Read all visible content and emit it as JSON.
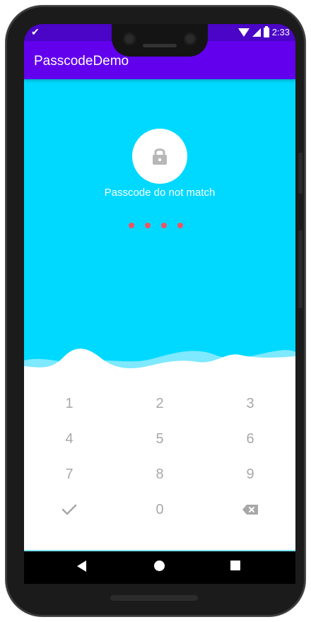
{
  "status_bar": {
    "time": "2:33",
    "notification_icon": "check-icon",
    "icons": [
      "wifi-icon",
      "signal-icon",
      "battery-icon"
    ],
    "background_color": "#4a05c7"
  },
  "app_bar": {
    "title": "PasscodeDemo",
    "background_color": "#6200ee"
  },
  "lock": {
    "icon": "lock-icon",
    "message": "Passcode do not match",
    "background_color": "#00d9ff",
    "entered_digits": 4,
    "dot_color": "#f25260"
  },
  "keypad": {
    "rows": [
      [
        "1",
        "2",
        "3"
      ],
      [
        "4",
        "5",
        "6"
      ],
      [
        "7",
        "8",
        "9"
      ]
    ],
    "bottom_row": {
      "left_icon": "checkmark-icon",
      "zero": "0",
      "right_icon": "backspace-icon"
    },
    "text_color": "#a8a8a8"
  },
  "nav_bar": {
    "buttons": [
      "back-icon",
      "home-icon",
      "recents-icon"
    ]
  }
}
